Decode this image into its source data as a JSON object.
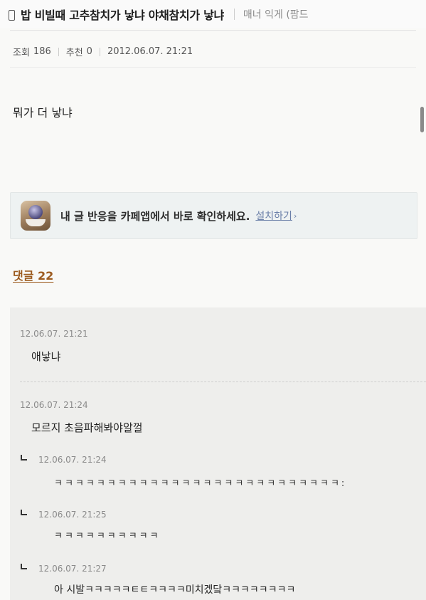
{
  "header": {
    "title": "밥 비빌때 고추참치가 낳냐 야채참치가 낳냐",
    "board": "매너 익게 (팜드"
  },
  "meta": {
    "views_label": "조회",
    "views": "186",
    "recommend_label": "추천",
    "recommend": "0",
    "datetime": "2012.06.07. 21:21"
  },
  "post": {
    "body": "뭐가 더 낳냐"
  },
  "banner": {
    "text": "내 글 반응을 카페앱에서 바로 확인하세요.",
    "link": "설치하기",
    "arrow": "›"
  },
  "comments": {
    "header": "댓글 22",
    "items": [
      {
        "date": "12.06.07. 21:21",
        "text": "애낳냐"
      },
      {
        "date": "12.06.07. 21:24",
        "text": "모르지 초음파해봐야알껄"
      }
    ],
    "replies": [
      {
        "date": "12.06.07. 21:24",
        "text": "ㅋㅋㅋㅋㅋㅋㅋㅋㅋㅋㅋㅋㅋㅋㅋㅋㅋㅋㅋㅋㅋㅋㅋㅋㅋㅋㅋ:"
      },
      {
        "date": "12.06.07. 21:25",
        "text": "ㅋㅋㅋㅋㅋㅋㅋㅋㅋㅋ"
      },
      {
        "date": "12.06.07. 21:27",
        "text": "아 시발ㅋㅋㅋㅋㅋㅌㅌㅋㅋㅋㅋ미치겠닼ㅋㅋㅋㅋㅋㅋㅋㅋ"
      }
    ]
  },
  "colors": {
    "comments_header": "#9c5b1f",
    "install_link": "#6a7fa8",
    "comment_bg": "#eeeeec"
  }
}
